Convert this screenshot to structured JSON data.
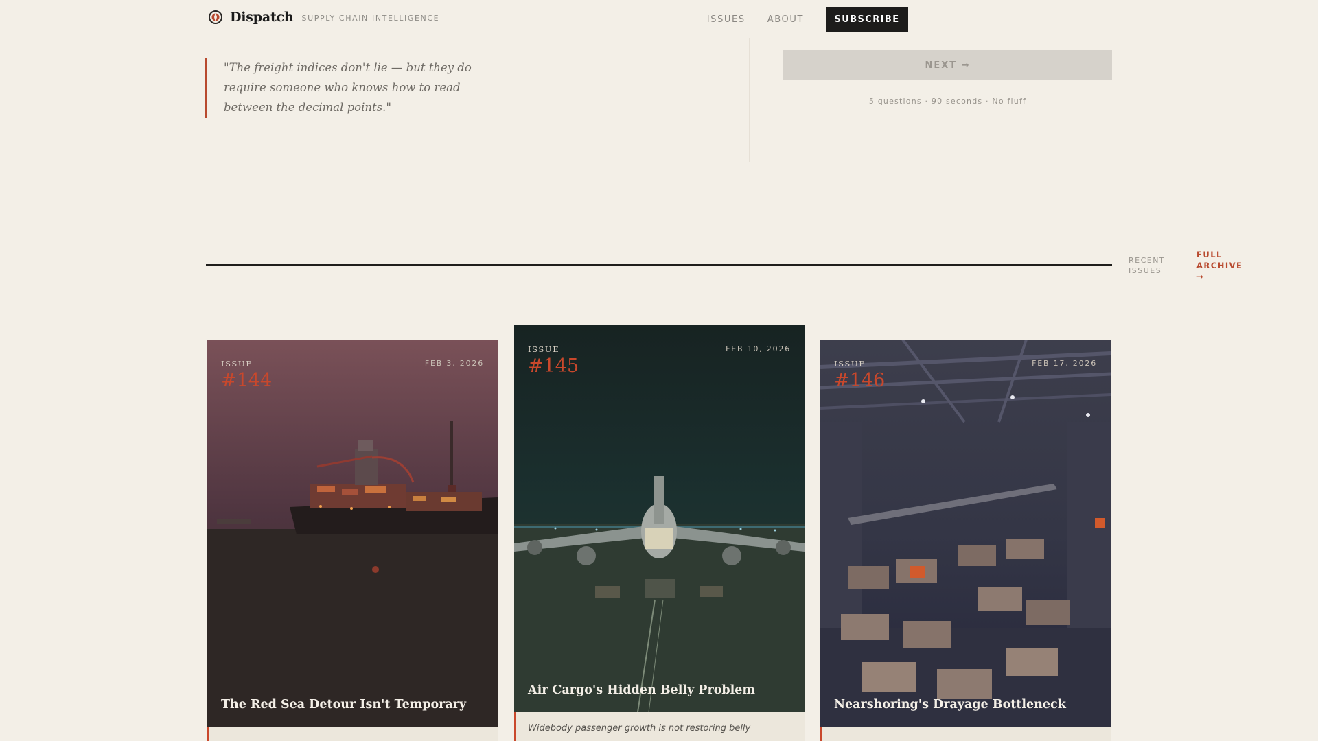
{
  "brand": {
    "name": "Dispatch",
    "tagline": "SUPPLY CHAIN INTELLIGENCE"
  },
  "nav": {
    "issues": "ISSUES",
    "about": "ABOUT",
    "subscribe": "SUBSCRIBE"
  },
  "quote": {
    "text": "\"The freight indices don't lie — but they do require someone who knows how to read between the decimal points.\""
  },
  "quiz": {
    "next_label": "NEXT →",
    "meta": "5 questions · 90 seconds · No fluff"
  },
  "recent": {
    "label": "RECENT ISSUES",
    "archive_link": "FULL ARCHIVE →"
  },
  "issues": [
    {
      "issue_word": "ISSUE",
      "number": "#144",
      "date": "FEB 3, 2026",
      "title": "The Red Sea Detour Isn't Temporary",
      "excerpt": ""
    },
    {
      "issue_word": "ISSUE",
      "number": "#145",
      "date": "FEB 10, 2026",
      "title": "Air Cargo's Hidden Belly Problem",
      "excerpt": "Widebody passenger growth is not restoring belly"
    },
    {
      "issue_word": "ISSUE",
      "number": "#146",
      "date": "FEB 17, 2026",
      "title": "Nearshoring's Drayage Bottleneck",
      "excerpt": ""
    }
  ],
  "colors": {
    "background": "#f3efe7",
    "accent": "#b84a2f",
    "ink": "#1d1c1b"
  }
}
